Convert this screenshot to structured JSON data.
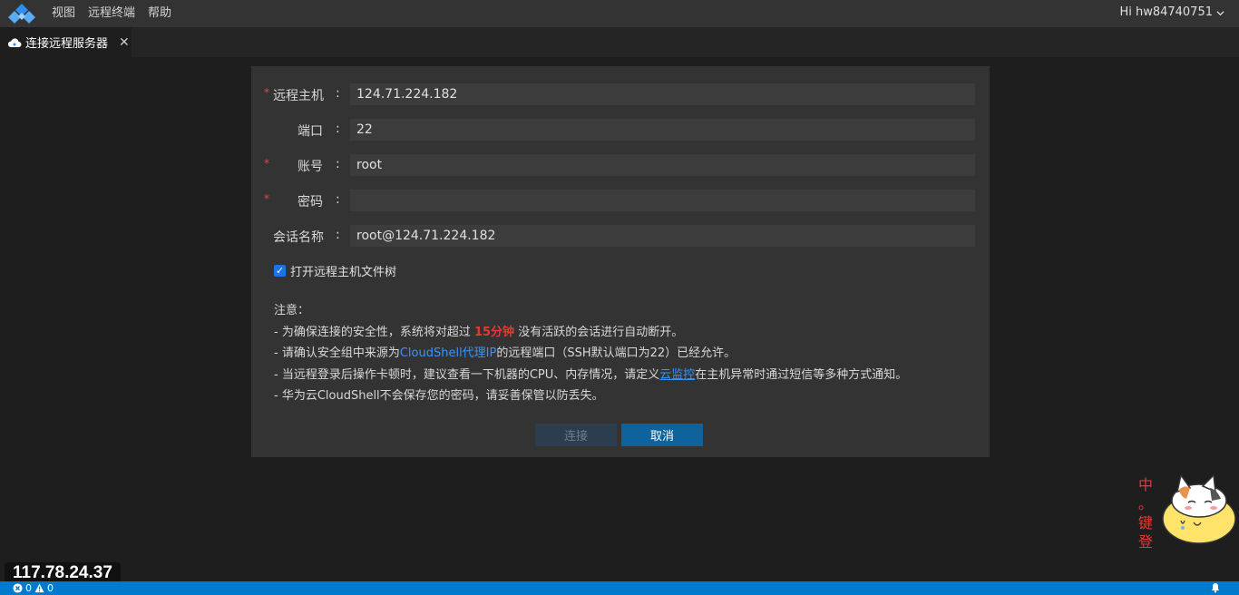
{
  "menubar": {
    "items": [
      "视图",
      "远程终端",
      "帮助"
    ],
    "user": "Hi hw84740751"
  },
  "tab": {
    "title": "连接远程服务器"
  },
  "form": {
    "host": {
      "label": "远程主机",
      "value": "124.71.224.182",
      "required": true
    },
    "port": {
      "label": "端口",
      "value": "22",
      "required": false
    },
    "account": {
      "label": "账号",
      "value": "root",
      "required": true
    },
    "password": {
      "label": "密码",
      "value": "",
      "required": true
    },
    "session": {
      "label": "会话名称",
      "value": "root@124.71.224.182",
      "required": false
    },
    "colon": ":",
    "checkbox_label": "打开远程主机文件树",
    "checkbox_checked": true
  },
  "notes": {
    "title": "注意：",
    "line1_pre": "- 为确保连接的安全性，系统将对超过 ",
    "line1_red": "15分钟",
    "line1_post": " 没有活跃的会话进行自动断开。",
    "line2_pre": "- 请确认安全组中来源为",
    "line2_blue": "CloudShell代理IP",
    "line2_post": "的远程端口（SSH默认端口为22）已经允许。",
    "line3_pre": "- 当远程登录后操作卡顿时，建议查看一下机器的CPU、内存情况，请定义",
    "line3_link": "云监控",
    "line3_post": "在主机异常时通过短信等多种方式通知。",
    "line4": "- 华为云CloudShell不会保存您的密码，请妥善保管以防丢失。"
  },
  "buttons": {
    "connect": "连接",
    "cancel": "取消"
  },
  "ime": {
    "lines": [
      "中",
      "。",
      "键",
      "登"
    ]
  },
  "overlay_ip": "117.78.24.37",
  "status": {
    "errors": "0",
    "warnings": "0"
  },
  "colors": {
    "accent": "#007acc",
    "primary_button": "#0e639c",
    "required": "#e04848",
    "highlight_red": "#e53935",
    "link": "#3794ff"
  }
}
